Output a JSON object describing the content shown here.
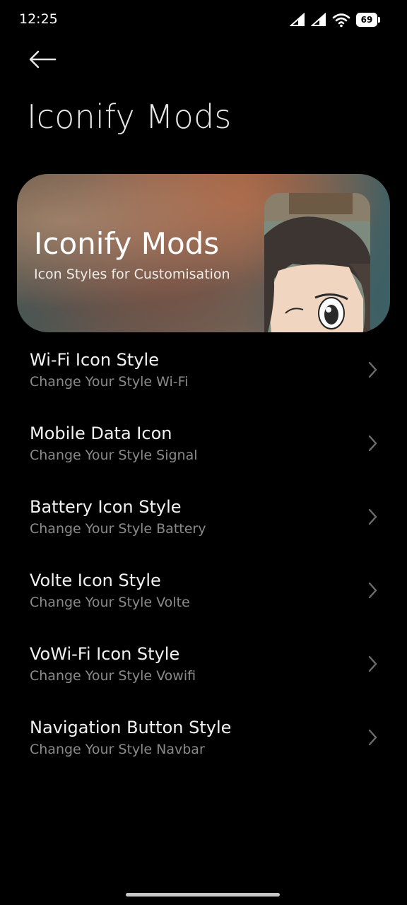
{
  "status_bar": {
    "time": "12:25",
    "battery_level": "69",
    "icons": [
      "signal-icon",
      "signal-icon",
      "wifi-icon",
      "battery-icon"
    ]
  },
  "header": {
    "back_icon": "back-arrow-icon",
    "title": "Iconify Mods"
  },
  "banner": {
    "title": "Iconify Mods",
    "subtitle": "Icon Styles for Customisation"
  },
  "menu": {
    "items": [
      {
        "title": "Wi-Fi Icon Style",
        "subtitle": "Change Your Style Wi-Fi"
      },
      {
        "title": "Mobile Data Icon",
        "subtitle": "Change Your Style Signal"
      },
      {
        "title": "Battery Icon Style",
        "subtitle": "Change Your Style Battery"
      },
      {
        "title": "Volte Icon Style",
        "subtitle": "Change Your Style Volte"
      },
      {
        "title": "VoWi-Fi Icon Style",
        "subtitle": "Change Your Style Vowifi"
      },
      {
        "title": "Navigation Button Style",
        "subtitle": "Change Your Style Navbar"
      }
    ],
    "chevron_icon": "chevron-right-icon"
  },
  "colors": {
    "background": "#000000",
    "title_text": "#f2f2f2",
    "subtitle_text": "#8a8a8a"
  }
}
